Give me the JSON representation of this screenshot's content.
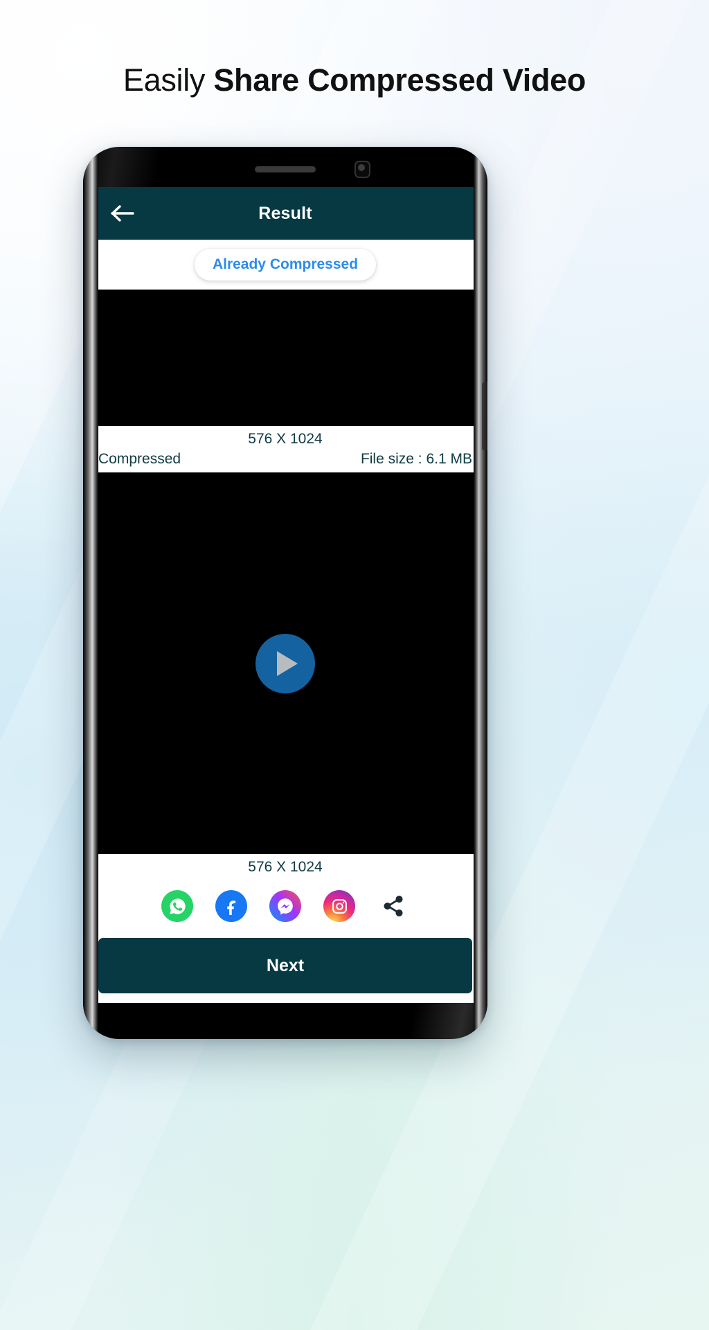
{
  "page": {
    "headline_light": "Easily ",
    "headline_strong": "Share Compressed Video",
    "background_color": "#e6f3fb"
  },
  "phone": {
    "speaker_icon": "speaker-grill",
    "camera_icon": "front-camera-icon"
  },
  "app": {
    "appbar": {
      "back_icon": "back-arrow-icon",
      "title": "Result",
      "background_color": "#073943",
      "title_color": "#ffffff"
    },
    "status_chip": {
      "label": "Already Compressed",
      "text_color": "#2b8ced"
    },
    "original_video": {
      "preview_icon": "video-thumbnail",
      "dimensions": "576 X 1024"
    },
    "meta": {
      "state_label": "Compressed",
      "file_size_label": "File size : 6.1 MB"
    },
    "compressed_video": {
      "preview_icon": "video-thumbnail",
      "play_icon": "play-icon",
      "play_button_color": "#1562a0",
      "dimensions": "576 X 1024"
    },
    "share": [
      {
        "name": "whatsapp-icon",
        "label": "WhatsApp",
        "color": "#25d366"
      },
      {
        "name": "facebook-icon",
        "label": "Facebook",
        "color": "#1877f2"
      },
      {
        "name": "messenger-icon",
        "label": "Messenger",
        "color": "#0695ff"
      },
      {
        "name": "instagram-icon",
        "label": "Instagram",
        "color": "#ee2a7b"
      },
      {
        "name": "share-icon",
        "label": "More",
        "color": "#1d2a33"
      }
    ],
    "next_button": {
      "label": "Next",
      "background_color": "#073943"
    }
  }
}
